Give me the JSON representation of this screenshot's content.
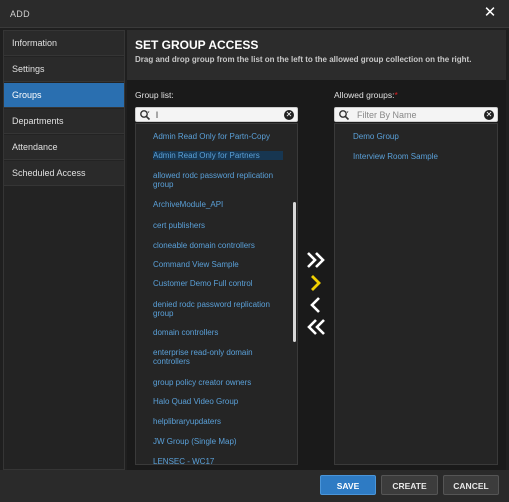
{
  "window": {
    "title": "ADD"
  },
  "sidebar": {
    "items": [
      {
        "label": "Information"
      },
      {
        "label": "Settings"
      },
      {
        "label": "Groups",
        "active": true
      },
      {
        "label": "Departments"
      },
      {
        "label": "Attendance"
      },
      {
        "label": "Scheduled Access"
      }
    ]
  },
  "header": {
    "title": "SET GROUP ACCESS",
    "subtitle": "Drag and drop group from the list on the left to the allowed group collection on the right."
  },
  "group_list": {
    "label": "Group list:",
    "search_value": "l",
    "items": [
      "Admin Read Only for Partn-Copy",
      "Admin Read Only for Partners",
      "allowed rodc password replication group",
      "ArchiveModule_API",
      "cert publishers",
      "cloneable domain controllers",
      "Command View Sample",
      "Customer Demo Full control",
      "denied rodc password replication group",
      "domain controllers",
      "enterprise read-only domain controllers",
      "group policy creator owners",
      "Halo Quad Video Group",
      "helplibraryupdaters",
      "JW Group (Single Map)",
      "LENSEC - WC17"
    ],
    "selected_index": 1
  },
  "allowed_groups": {
    "label": "Allowed groups:",
    "required_mark": "*",
    "search_placeholder": "Filter By Name",
    "items": [
      "Demo Group",
      "Interview Room Sample"
    ]
  },
  "transfer": {
    "icons": [
      "move-all-right-icon",
      "move-right-icon",
      "move-left-icon",
      "move-all-left-icon"
    ],
    "highlight_color": "#f0d000"
  },
  "footer": {
    "save_label": "SAVE",
    "create_label": "CREATE",
    "cancel_label": "CANCEL"
  },
  "colors": {
    "accent": "#2e7bc4",
    "link": "#5aa0d8",
    "required": "#dd2222"
  }
}
